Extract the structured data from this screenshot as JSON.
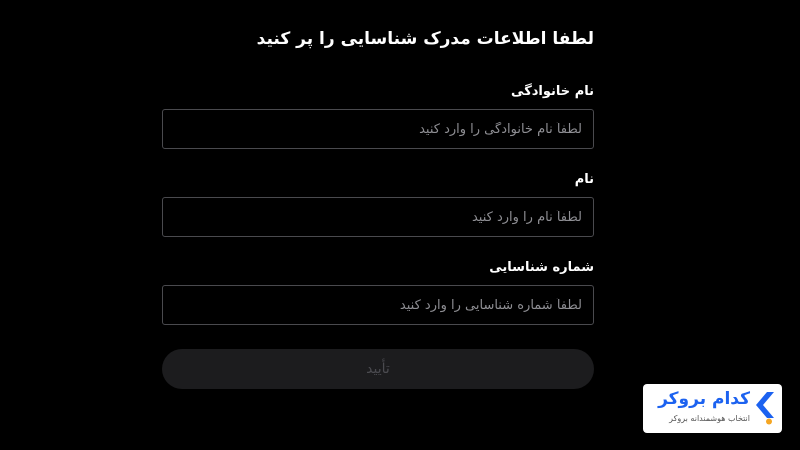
{
  "form": {
    "title": "لطفا اطلاعات مدرک شناسایی را پر کنید",
    "fields": [
      {
        "label": "نام خانوادگی",
        "value": "",
        "placeholder": "لطفاً نام خانوادگی را وارد کنید"
      },
      {
        "label": "نام",
        "value": "",
        "placeholder": "لطفاً نام را وارد کنید"
      },
      {
        "label": "شماره شناسایی",
        "value": "",
        "placeholder": "لطفاً شماره شناسایی را وارد کنید"
      }
    ],
    "submit_label": "تأیید",
    "submit_disabled": true
  },
  "brand": {
    "name": "کدام بروکر",
    "tagline": "انتخاب هوشمندانه بروکر",
    "primary_color": "#1c62f0",
    "accent_color": "#f5a623",
    "icon": "chevron-logo-icon"
  },
  "colors": {
    "background": "#000000",
    "text": "#ffffff",
    "input_border": "#4a4a4e",
    "placeholder": "#8e8e93",
    "button_bg": "#1c1c1e",
    "button_text": "#4b4b50"
  }
}
